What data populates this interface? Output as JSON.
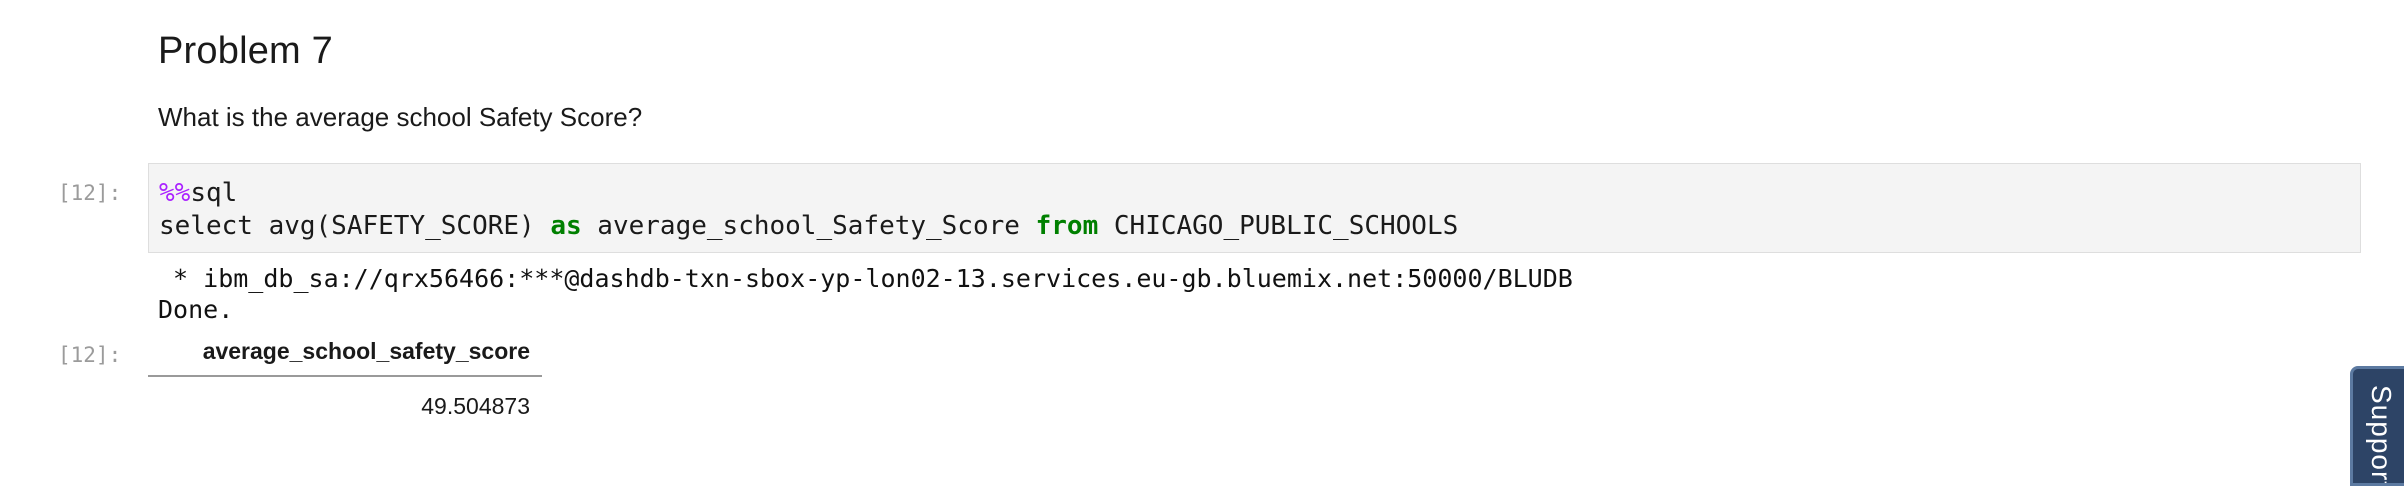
{
  "markdown": {
    "heading": "Problem 7",
    "question": "What is the average school Safety Score?"
  },
  "code_cell": {
    "prompt": "[12]:",
    "line1": {
      "magic": "%%",
      "text": "sql"
    },
    "line2": {
      "part1": "select avg(SAFETY_SCORE) ",
      "kw1": "as",
      "part2": " average_school_Safety_Score ",
      "kw2": "from",
      "part3": " CHICAGO_PUBLIC_SCHOOLS"
    }
  },
  "stream_output": {
    "connection": " * ibm_db_sa://qrx56466:***@dashdb-txn-sbox-yp-lon02-13.services.eu-gb.bluemix.net:50000/BLUDB",
    "status": "Done."
  },
  "result": {
    "prompt": "[12]:",
    "columns": [
      "average_school_safety_score"
    ],
    "rows": [
      [
        "49.504873"
      ]
    ]
  },
  "support_tab": {
    "label": "Support"
  }
}
